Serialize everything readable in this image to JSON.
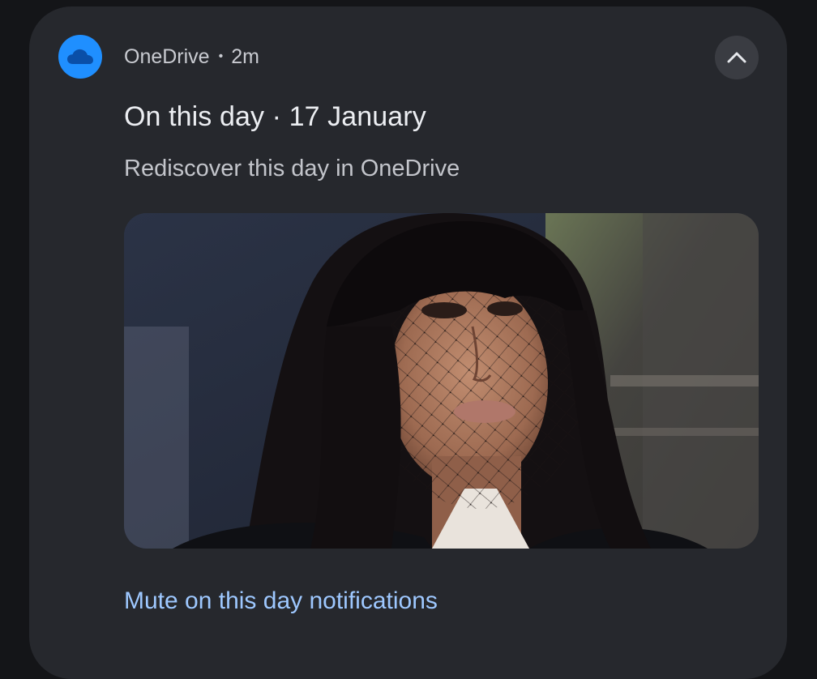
{
  "notification": {
    "app_name": "OneDrive",
    "separator": "•",
    "time_ago": "2m",
    "app_icon": "onedrive-cloud-icon",
    "title": "On this day · 17 January",
    "body": "Rediscover this day in OneDrive",
    "action_label": "Mute on this day notifications",
    "expand_icon": "chevron-up-icon"
  },
  "colors": {
    "card_bg": "#26282d",
    "app_icon_bg": "#1f8fff",
    "action_text": "#9ec8ff"
  }
}
